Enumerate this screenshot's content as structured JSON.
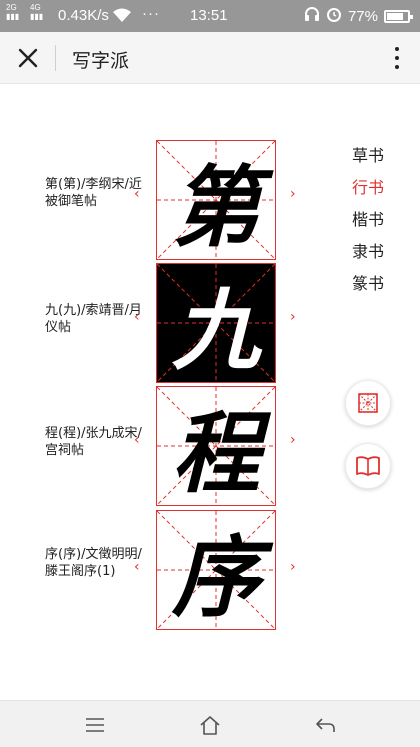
{
  "status_bar": {
    "signal_1": "2G",
    "signal_2": "4G",
    "net_speed": "0.43K/s",
    "time": "13:51",
    "battery": "77%"
  },
  "title_bar": {
    "title": "写字派"
  },
  "characters": [
    {
      "char": "第",
      "caption": "第(第)/李纲宋/近被御笔帖",
      "active": false
    },
    {
      "char": "九",
      "caption": "九(九)/索靖晋/月仪帖",
      "active": true
    },
    {
      "char": "程",
      "caption": "程(程)/张九成宋/宫祠帖",
      "active": false
    },
    {
      "char": "序",
      "caption": "序(序)/文徵明明/滕王阁序(1)",
      "active": false
    }
  ],
  "arrows": {
    "left": "‹",
    "right": "›"
  },
  "script_styles": [
    {
      "label": "草书",
      "selected": false
    },
    {
      "label": "行书",
      "selected": true
    },
    {
      "label": "楷书",
      "selected": false
    },
    {
      "label": "隶书",
      "selected": false
    },
    {
      "label": "篆书",
      "selected": false
    }
  ],
  "colors": {
    "accent": "#e0312f",
    "status_bar": "#979797",
    "title_bar": "#f5f5f5"
  },
  "icons": [
    "close-icon",
    "more-icon",
    "grid-icon",
    "book-icon",
    "menu-icon",
    "home-icon",
    "back-icon"
  ]
}
